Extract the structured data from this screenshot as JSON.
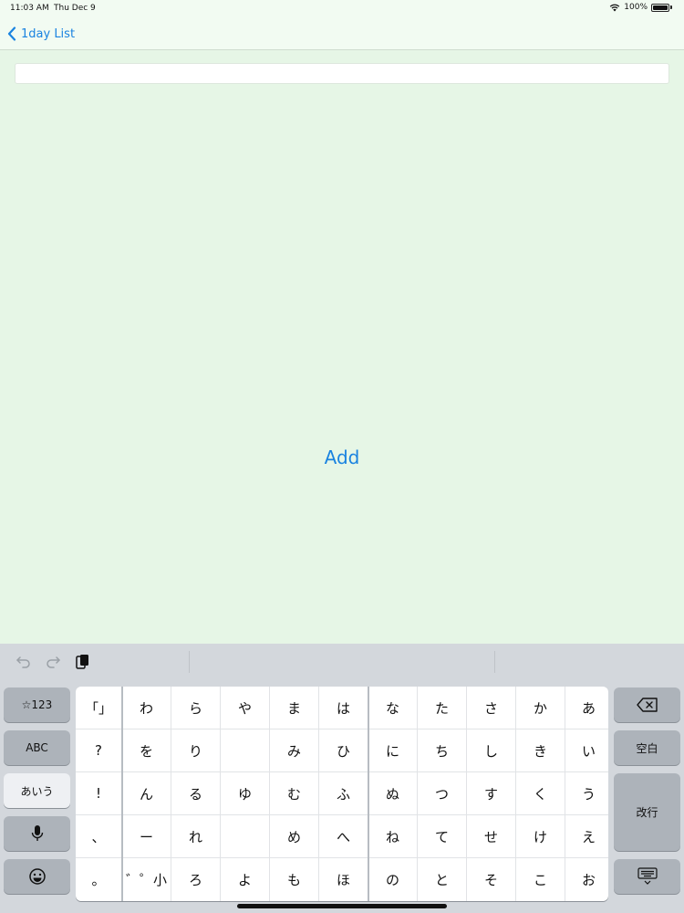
{
  "status": {
    "time": "11:03 AM",
    "date": "Thu Dec 9",
    "battery": "100%"
  },
  "nav": {
    "back_label": "1day List"
  },
  "main": {
    "add_label": "Add",
    "input_value": ""
  },
  "keyboard": {
    "left_keys": [
      "☆123",
      "ABC",
      "あいう"
    ],
    "right_keys": {
      "space": "空白",
      "return": "改行"
    },
    "grid_rows": [
      [
        "「」",
        "わ",
        "ら",
        "や",
        "ま",
        "は",
        "な",
        "た",
        "さ",
        "か",
        "あ"
      ],
      [
        "?",
        "を",
        "り",
        "",
        "み",
        "ひ",
        "に",
        "ち",
        "し",
        "き",
        "い"
      ],
      [
        "!",
        "ん",
        "る",
        "ゆ",
        "む",
        "ふ",
        "ぬ",
        "つ",
        "す",
        "く",
        "う"
      ],
      [
        "、",
        "ー",
        "れ",
        "",
        "め",
        "へ",
        "ね",
        "て",
        "せ",
        "け",
        "え"
      ],
      [
        "。",
        "゛゜小",
        "ろ",
        "よ",
        "も",
        "ほ",
        "の",
        "と",
        "そ",
        "こ",
        "お"
      ]
    ]
  }
}
